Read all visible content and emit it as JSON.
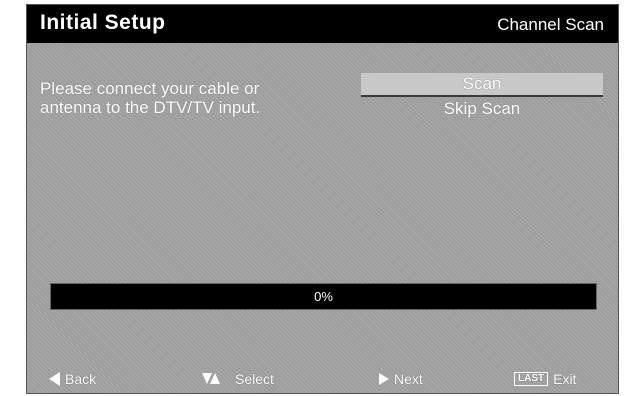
{
  "header": {
    "title": "Initial  Setup",
    "subtitle": "Channel Scan"
  },
  "message": {
    "line1": "Please connect your cable or",
    "line2": "antenna to the DTV/TV input."
  },
  "menu": {
    "items": [
      {
        "label": "Scan",
        "selected": true
      },
      {
        "label": "Skip Scan",
        "selected": false
      }
    ]
  },
  "progress": {
    "label": "0%",
    "value": 0
  },
  "footer": {
    "back_label": "Back",
    "select_label": "Select",
    "next_label": "Next",
    "exit_key": "LAST",
    "exit_label": "Exit",
    "icons": {
      "back": "left-arrow-icon",
      "select": "up-down-arrows-icon",
      "next": "right-arrow-icon",
      "exit": "last-key-icon"
    }
  },
  "colors": {
    "background": "#9e9e9e",
    "titlebar": "#000000",
    "text": "#ffffff",
    "selection": "#c8c8c8"
  }
}
